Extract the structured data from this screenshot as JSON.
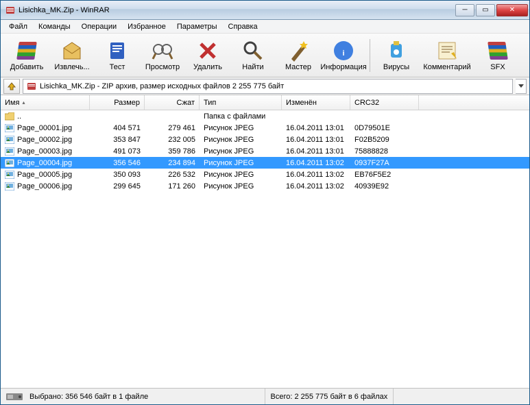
{
  "window": {
    "title": "Lisichka_MK.Zip - WinRAR"
  },
  "menu": {
    "file": "Файл",
    "commands": "Команды",
    "operations": "Операции",
    "favorites": "Избранное",
    "parameters": "Параметры",
    "help": "Справка"
  },
  "toolbar": {
    "add": "Добавить",
    "extract": "Извлечь...",
    "test": "Тест",
    "view": "Просмотр",
    "delete": "Удалить",
    "find": "Найти",
    "wizard": "Мастер",
    "info": "Информация",
    "virus": "Вирусы",
    "comment": "Комментарий",
    "sfx": "SFX"
  },
  "address": {
    "text": "Lisichka_MK.Zip - ZIP архив, размер исходных файлов 2 255 775 байт"
  },
  "columns": {
    "name": "Имя",
    "size": "Размер",
    "packed": "Сжат",
    "type": "Тип",
    "modified": "Изменён",
    "crc": "CRC32"
  },
  "parent": {
    "name": "..",
    "type": "Папка с файлами"
  },
  "files": [
    {
      "name": "Page_00001.jpg",
      "size": "404 571",
      "packed": "279 461",
      "type": "Рисунок JPEG",
      "modified": "16.04.2011 13:01",
      "crc": "0D79501E"
    },
    {
      "name": "Page_00002.jpg",
      "size": "353 847",
      "packed": "232 005",
      "type": "Рисунок JPEG",
      "modified": "16.04.2011 13:01",
      "crc": "F02B5209"
    },
    {
      "name": "Page_00003.jpg",
      "size": "491 073",
      "packed": "359 786",
      "type": "Рисунок JPEG",
      "modified": "16.04.2011 13:01",
      "crc": "75888828"
    },
    {
      "name": "Page_00004.jpg",
      "size": "356 546",
      "packed": "234 894",
      "type": "Рисунок JPEG",
      "modified": "16.04.2011 13:02",
      "crc": "0937F27A",
      "selected": true
    },
    {
      "name": "Page_00005.jpg",
      "size": "350 093",
      "packed": "226 532",
      "type": "Рисунок JPEG",
      "modified": "16.04.2011 13:02",
      "crc": "EB76F5E2"
    },
    {
      "name": "Page_00006.jpg",
      "size": "299 645",
      "packed": "171 260",
      "type": "Рисунок JPEG",
      "modified": "16.04.2011 13:02",
      "crc": "40939E92"
    }
  ],
  "status": {
    "selected": "Выбрано: 356 546 байт в 1 файле",
    "total": "Всего: 2 255 775 байт в 6 файлах"
  }
}
